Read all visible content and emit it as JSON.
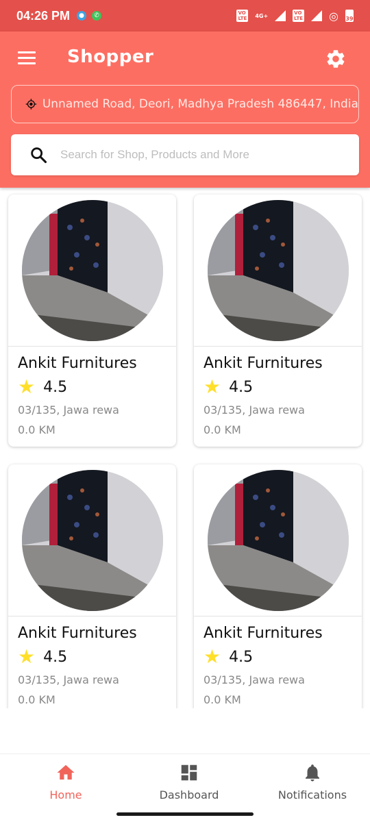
{
  "status": {
    "time": "04:26 PM",
    "battery": "39",
    "net": "4G+"
  },
  "header": {
    "title": "Shopper",
    "location": "Unnamed Road, Deori, Madhya Pradesh 486447, India",
    "search_placeholder": "Search for Shop, Products and More"
  },
  "shops": [
    {
      "name": "Ankit Furnitures",
      "rating": "4.5",
      "address": "03/135, Jawa rewa",
      "distance": "0.0 KM"
    },
    {
      "name": "Ankit Furnitures",
      "rating": "4.5",
      "address": "03/135, Jawa rewa",
      "distance": "0.0 KM"
    },
    {
      "name": "Ankit Furnitures",
      "rating": "4.5",
      "address": "03/135, Jawa rewa",
      "distance": "0.0 KM"
    },
    {
      "name": "Ankit Furnitures",
      "rating": "4.5",
      "address": "03/135, Jawa rewa",
      "distance": "0.0 KM"
    }
  ],
  "nav": [
    {
      "label": "Home",
      "icon": "home-icon",
      "active": true
    },
    {
      "label": "Dashboard",
      "icon": "dashboard-icon",
      "active": false
    },
    {
      "label": "Notifications",
      "icon": "bell-icon",
      "active": false
    }
  ],
  "colors": {
    "primary": "#fd6e62",
    "statusbar": "#e4504b",
    "star": "#ffdf2a",
    "active_nav": "#f0645a",
    "inactive_nav": "#555555"
  }
}
